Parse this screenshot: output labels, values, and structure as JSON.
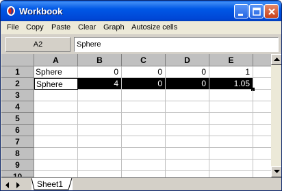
{
  "window": {
    "title": "Workbook"
  },
  "menu": [
    "File",
    "Copy",
    "Paste",
    "Clear",
    "Graph",
    "Autosize cells"
  ],
  "formula_bar": {
    "cell_ref": "A2",
    "value": "Sphere"
  },
  "columns": [
    "A",
    "B",
    "C",
    "D",
    "E"
  ],
  "rows": [
    "1",
    "2",
    "3",
    "4",
    "5",
    "6",
    "7",
    "8",
    "9",
    "10"
  ],
  "cells": {
    "r1": [
      "Sphere",
      "0",
      "0",
      "0",
      "1"
    ],
    "r2": [
      "Sphere",
      "4",
      "0",
      "0",
      "1.05"
    ]
  },
  "sheet_tabs": [
    "Sheet1"
  ],
  "colors": {
    "title_bar": "#0058e6",
    "selection": "#000000",
    "header_bg": "#c0c0c0"
  }
}
